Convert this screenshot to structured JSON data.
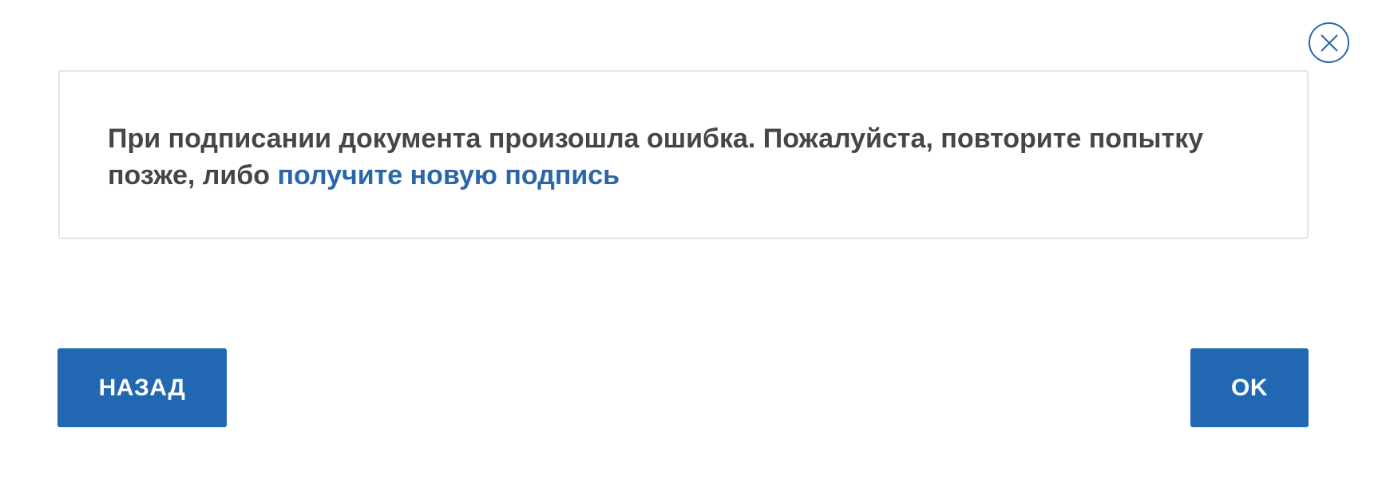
{
  "dialog": {
    "close_icon": "close-x-icon",
    "message": {
      "text_before_link": "При подписании документа произошла ошибка. Пожалуйста, повторите попытку позже, либо ",
      "link_text": "получите новую подпись"
    },
    "buttons": {
      "back_label": "НАЗАД",
      "ok_label": "OK"
    }
  },
  "colors": {
    "accent": "#2167b1",
    "link": "#2b67a8",
    "text": "#464646",
    "card_border": "#e6e6e6"
  }
}
